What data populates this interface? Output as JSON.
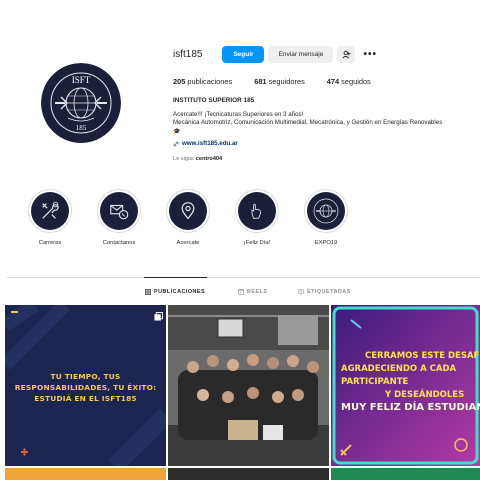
{
  "profile": {
    "username": "isft185",
    "follow_label": "Seguir",
    "message_label": "Enviar mensaje",
    "stats": {
      "posts_count": "205",
      "posts_label": "publicaciones",
      "followers_count": "681",
      "followers_label": "seguidores",
      "following_count": "474",
      "following_label": "seguidos"
    },
    "full_name": "INSTITUTO SUPERIOR 185",
    "bio_line1": "Acercate!!! ¡Tecnicaturas Superiores en 3 años!",
    "bio_line2": "Mecánica Automotriz, Comunicación Multimedial, Mecatrónica, y Gestión en Energías Renovables",
    "link": "www.isft185.edu.ar",
    "followed_by_prefix": "Le sigue",
    "followed_by_user": "centro404",
    "avatar_text_top": "ISFT",
    "avatar_text_bottom": "185"
  },
  "highlights": [
    {
      "label": "Carreras",
      "icon": "tools-icon"
    },
    {
      "label": "Contactanos",
      "icon": "contact-icon"
    },
    {
      "label": "Acercate",
      "icon": "location-pin-icon"
    },
    {
      "label": "¡Feliz Día!",
      "icon": "hand-icon"
    },
    {
      "label": "EXPO19",
      "icon": "logo-icon"
    }
  ],
  "tabs": [
    {
      "label": "PUBLICACIONES",
      "active": true
    },
    {
      "label": "REELS",
      "active": false
    },
    {
      "label": "ETIQUETADAS",
      "active": false
    }
  ],
  "posts": {
    "post1_line1": "TU TIEMPO, TUS RESPONSABILIDADES, TU ÉXITO:",
    "post1_line2": "ESTUDIÁ EN EL ISFT185",
    "post3_line1": "CERRAMOS ESTE DESAFÍO",
    "post3_line2": "AGRADECIENDO A CADA PARTICIPANTE",
    "post3_line3": "Y DESEÁNDOLES",
    "post3_line4": "MUY FELIZ DÍA ESTUDIANTES!!"
  },
  "colors": {
    "accent": "#0095f6",
    "brand_navy": "#1b1f3a",
    "post_yellow": "#f6c84b"
  }
}
